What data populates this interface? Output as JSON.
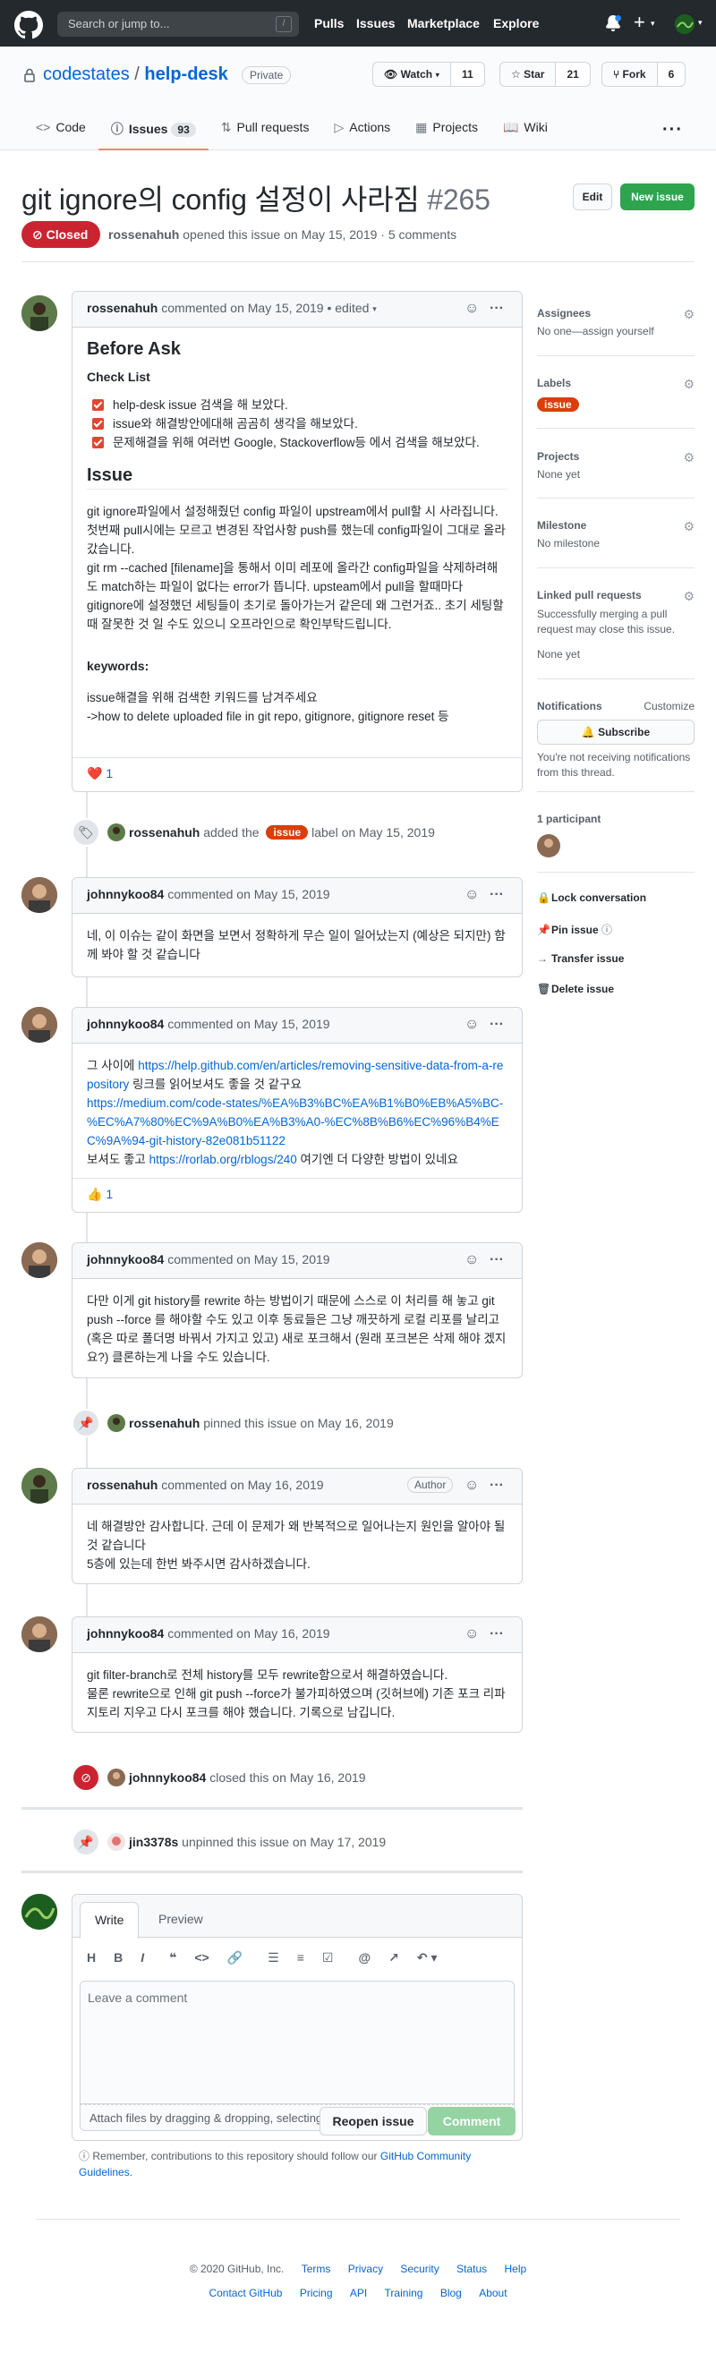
{
  "header": {
    "search_placeholder": "Search or jump to...",
    "slash": "/",
    "nav": [
      "Pulls",
      "Issues",
      "Marketplace",
      "Explore"
    ]
  },
  "repo": {
    "owner": "codestates",
    "divider": "/",
    "name": "help-desk",
    "visibility": "Private",
    "watch_label": "Watch",
    "watch_count": "11",
    "star_label": "Star",
    "star_count": "21",
    "fork_label": "Fork",
    "fork_count": "6",
    "tabs": [
      {
        "label": "Code"
      },
      {
        "label": "Issues",
        "count": "93"
      },
      {
        "label": "Pull requests"
      },
      {
        "label": "Actions"
      },
      {
        "label": "Projects"
      },
      {
        "label": "Wiki"
      }
    ]
  },
  "issue": {
    "title": "git ignore의 config 설정이 사라짐",
    "number": "#265",
    "edit_label": "Edit",
    "new_label": "New issue",
    "state": "Closed",
    "opener": "rossenahuh",
    "meta_text": "opened this issue on May 15, 2019 · 5 comments"
  },
  "comments": [
    {
      "author": "rossenahuh",
      "meta": "commented on May 15, 2019 • edited",
      "heading": "Before Ask",
      "subheading": "Check List",
      "checklist": [
        "help-desk issue 검색을 해 보았다.",
        "issue와 해결방안에대해 곰곰히 생각을 해보았다.",
        "문제해결을 위해 여러번 Google, Stackoverflow등 에서 검색을 해보았다."
      ],
      "issue_heading": "Issue",
      "body1": "git ignore파일에서 설정해줬던 config 파일이 upstream에서 pull할 시 사라집니다. 첫번째 pull시에는 모르고 변경된 작업사항 push를 했는데 config파일이 그대로 올라갔습니다.",
      "body2": "git rm --cached [filename]을 통해서 이미 레포에 올라간 config파일을 삭제하려해도 match하는 파일이 없다는 error가 뜹니다. upsteam에서 pull을 할때마다 gitignore에 설정했던 세팅들이 초기로 돌아가는거 같은데 왜 그런거죠.. 초기 세팅할때 잘못한 것 일 수도 있으니 오프라인으로 확인부탁드립니다.",
      "keywords_heading": "keywords:",
      "keywords1": "issue해결을 위해 검색한 키워드를 남겨주세요",
      "keywords2": "->how to delete uploaded file in git repo, gitignore, gitignore reset 등",
      "reaction_emoji": "❤️",
      "reaction_count": "1"
    },
    {
      "author": "johnnykoo84",
      "meta": "commented on May 15, 2019",
      "body": "네, 이 이슈는 같이 화면을 보면서 정확하게 무슨 일이 일어났는지 (예상은 되지만) 함께 봐야 할 것 같습니다"
    },
    {
      "author": "johnnykoo84",
      "meta": "commented on May 15, 2019",
      "text1": "그 사이에",
      "link1": "https://help.github.com/en/articles/removing-sensitive-data-from-a-repository",
      "text2": "링크를 읽어보셔도 좋을 것 같구요",
      "link2": "https://medium.com/code-states/%EA%B3%BC%EA%B1%B0%EB%A5%BC-%EC%A7%80%EC%9A%B0%EA%B3%A0-%EC%8B%B6%EC%96%B4%EC%9A%94-git-history-82e081b51122",
      "text3": "보셔도 좋고",
      "link3": "https://rorlab.org/rblogs/240",
      "text4": "여기엔 더 다양한 방법이 있네요",
      "reaction_emoji": "👍",
      "reaction_count": "1"
    },
    {
      "author": "johnnykoo84",
      "meta": "commented on May 15, 2019",
      "body": "다만 이게 git history를 rewrite 하는 방법이기 때문에 스스로 이 처리를 해 놓고 git push --force 를 해야할 수도 있고 이후 동료들은 그냥 깨끗하게 로컬 리포를 날리고 (혹은 따로 폴더명 바꿔서 가지고 있고) 새로 포크해서 (원래 포크본은 삭제 해야 겠지요?) 클론하는게 나을 수도 있습니다."
    },
    {
      "author": "rossenahuh",
      "meta": "commented on May 16, 2019",
      "badge": "Author",
      "body1": "네 해결방안 감사합니다. 근데 이 문제가 왜 반복적으로 일어나는지 원인을 알아야 될것 같습니다",
      "body2": "5층에 있는데 한번 봐주시면 감사하겠습니다."
    },
    {
      "author": "johnnykoo84",
      "meta": "commented on May 16, 2019",
      "body1": "git filter-branch로 전체 history를 모두 rewrite함으로서 해결하였습니다.",
      "body2": "물론 rewrite으로 인해 git push --force가 불가피하였으며 (깃허브에) 기존 포크 리파지토리 지우고 다시 포크를 해야 했습니다. 기록으로 남깁니다."
    }
  ],
  "events": [
    {
      "actor": "rossenahuh",
      "pre": "added the",
      "label": "issue",
      "post": "label on May 15, 2019"
    },
    {
      "actor": "rossenahuh",
      "text": "pinned this issue on May 16, 2019"
    },
    {
      "actor": "johnnykoo84",
      "text": "closed this on May 16, 2019"
    },
    {
      "actor": "jin3378s",
      "text": "unpinned this issue on May 17, 2019"
    }
  ],
  "sidebar": {
    "assignees_h": "Assignees",
    "assignees_v": "No one—assign yourself",
    "labels_h": "Labels",
    "label": "issue",
    "projects_h": "Projects",
    "projects_v": "None yet",
    "milestone_h": "Milestone",
    "milestone_v": "No milestone",
    "linked_h": "Linked pull requests",
    "linked_desc": "Successfully merging a pull request may close this issue.",
    "linked_v": "None yet",
    "notif_h": "Notifications",
    "customize": "Customize",
    "subscribe": "Subscribe",
    "notif_desc": "You're not receiving notifications from this thread.",
    "participants_h": "1 participant",
    "actions": [
      "Lock conversation",
      "Pin issue",
      "Transfer issue",
      "Delete issue"
    ]
  },
  "form": {
    "write_tab": "Write",
    "preview_tab": "Preview",
    "placeholder": "Leave a comment",
    "attach": "Attach files by dragging & dropping, selecting or pasting them.",
    "reopen": "Reopen issue",
    "comment": "Comment",
    "note_prefix": "Remember, contributions to this repository should follow our",
    "note_link": "GitHub Community Guidelines",
    "note_suffix": "."
  },
  "footer": {
    "row1": [
      "© 2020 GitHub, Inc.",
      "Terms",
      "Privacy",
      "Security",
      "Status",
      "Help"
    ],
    "row2": [
      "Contact GitHub",
      "Pricing",
      "API",
      "Training",
      "Blog",
      "About"
    ]
  },
  "colors": {
    "closed": "#cb2431",
    "new_issue": "#2ea44f",
    "label_issue": "#d93f0b",
    "link": "#0366d6"
  }
}
